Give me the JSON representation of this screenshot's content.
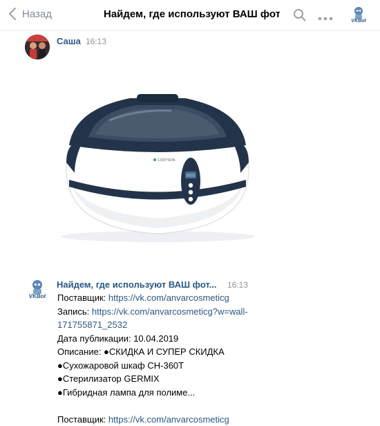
{
  "header": {
    "back_label": "Назад",
    "title": "Найдем, где используют ВАШ фот...",
    "app_badge": "VKBot"
  },
  "messages": [
    {
      "author": "Саша",
      "time": "16:13"
    },
    {
      "author": "Найдем, где используют ВАШ фот...",
      "time": "16:13",
      "badge": "VKBot"
    }
  ],
  "product": {
    "brand_text": "CODYSON",
    "display": "800"
  },
  "body": {
    "supplier_label": "Поставщик: ",
    "supplier_link": "https://vk.com/anvarcosmeticg",
    "post_label": "Запись: ",
    "post_link_1": "https://vk.com/anvarcosmeticg?w=wall-",
    "post_link_2": "171755871_2532",
    "date_line": "Дата публикации: 10.04.2019",
    "desc_line": "Описание: ●СКИДКА И СУПЕР СКИДКА",
    "item_1": "●Сухожаровой шкаф CH-360T",
    "item_2": "●Стерилизатор GERMIX",
    "item_3": "●Гибридная лампа для полиме...",
    "supplier_label_2": "Поставщик: ",
    "supplier_link_2": "https://vk.com/anvarcosmeticg"
  },
  "colors": {
    "link": "#2a5885",
    "muted": "#828a99",
    "device_navy": "#23344a"
  }
}
